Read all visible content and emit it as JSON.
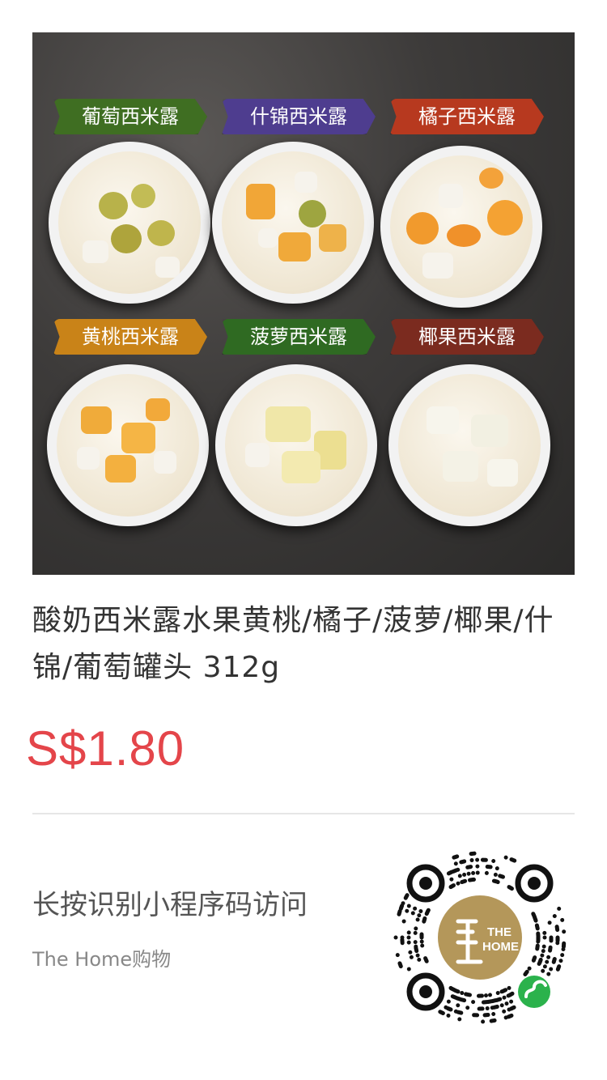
{
  "product": {
    "image_alt": "酸奶西米露水果罐头",
    "labels": [
      {
        "text": "葡萄西米露",
        "color": "#3f6e22"
      },
      {
        "text": "什锦西米露",
        "color": "#4e3d8f"
      },
      {
        "text": "橘子西米露",
        "color": "#b7391f"
      },
      {
        "text": "黄桃西米露",
        "color": "#c98318"
      },
      {
        "text": "菠萝西米露",
        "color": "#2f6a22"
      },
      {
        "text": "椰果西米露",
        "color": "#7b2b1f"
      }
    ],
    "title": "酸奶西米露水果黄桃/橘子/菠萝/椰果/什锦/葡萄罐头  312g",
    "price": "S$1.80"
  },
  "footer": {
    "cta": "长按识别小程序码访问",
    "shop_name": "The Home购物",
    "qr_logo_text_line1": "THE",
    "qr_logo_text_line2": "HOME",
    "icon": "mini-program-qr-code"
  },
  "colors": {
    "price": "#e4454a",
    "divider": "#e6e6e6",
    "qr_gold": "#b4975a",
    "mini_program_green": "#2bb24c"
  }
}
